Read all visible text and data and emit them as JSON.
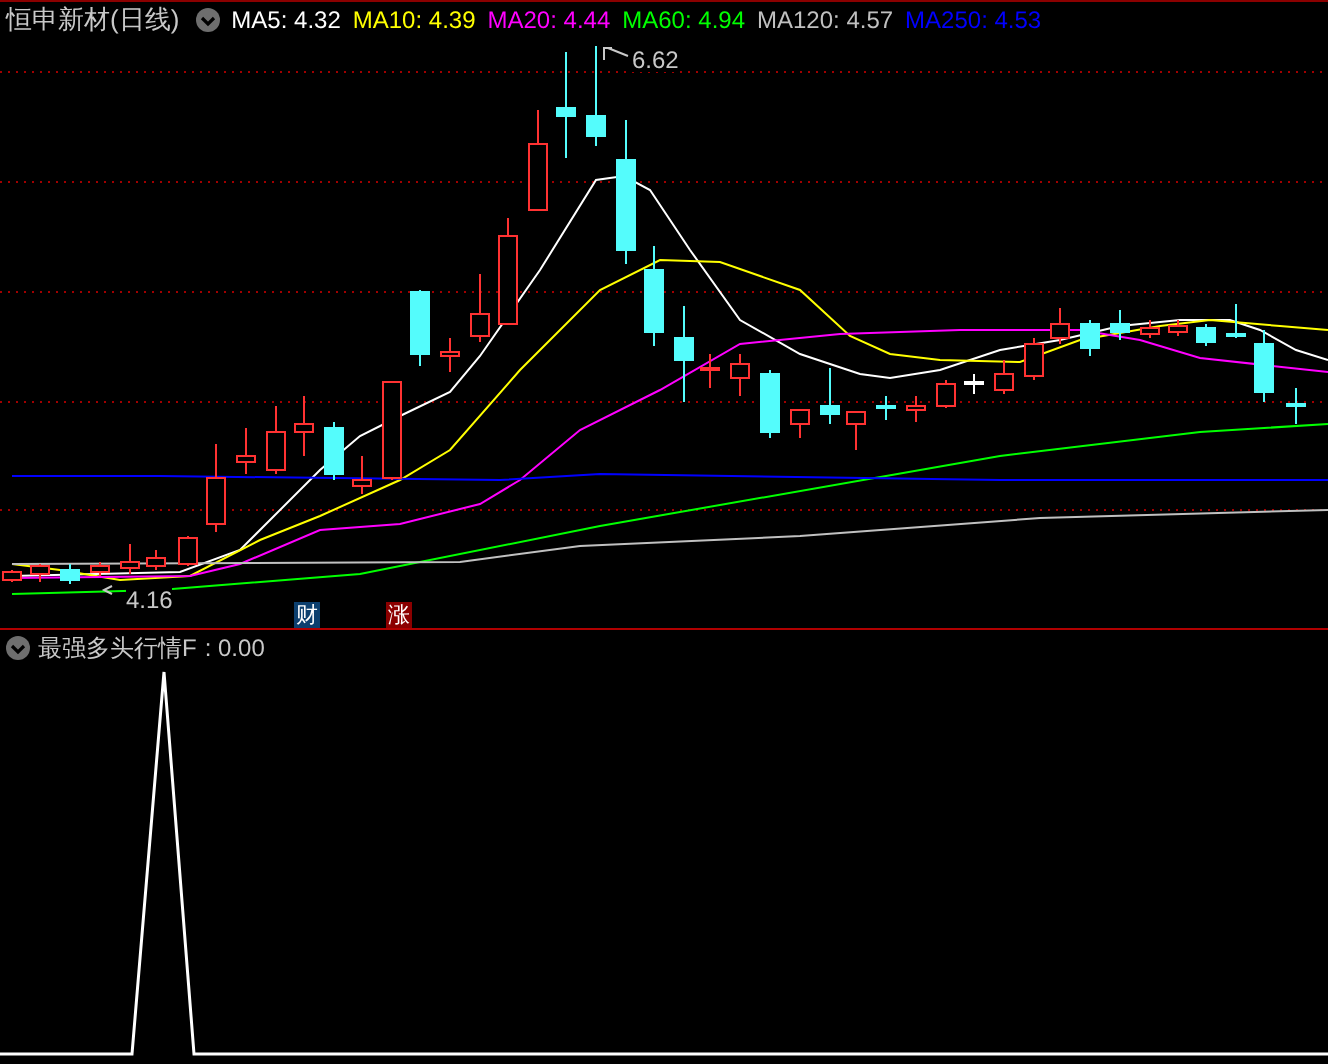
{
  "title": "恒申新材(日线)",
  "ma_legend": [
    {
      "text": "MA5: 4.32",
      "color": "#ffffff"
    },
    {
      "text": "MA10: 4.39",
      "color": "#ffff00"
    },
    {
      "text": "MA20: 4.44",
      "color": "#ff00ff"
    },
    {
      "text": "MA60: 4.94",
      "color": "#00ff00"
    },
    {
      "text": "MA120: 4.57",
      "color": "#c0c0c0"
    },
    {
      "text": "MA250: 4.53",
      "color": "#0000ff"
    }
  ],
  "price_labels": {
    "high": "6.62",
    "low": "4.16"
  },
  "event_markers": [
    {
      "text": "财",
      "color": "#0c3f6e"
    },
    {
      "text": "涨",
      "color": "#8b0000"
    }
  ],
  "indicator": {
    "name": "最强多头行情F",
    "value": ": 0.00"
  }
}
